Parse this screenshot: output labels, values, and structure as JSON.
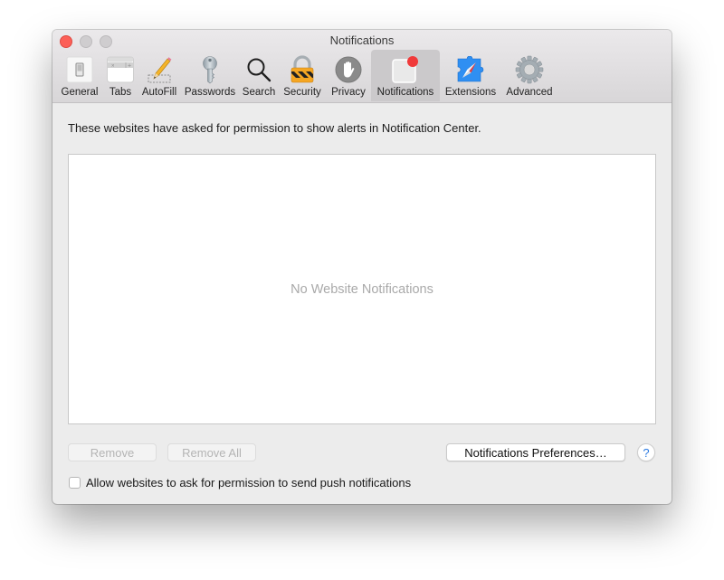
{
  "window": {
    "title": "Notifications",
    "controls": [
      "close",
      "minimize",
      "zoom"
    ]
  },
  "toolbar": {
    "selected": "Notifications",
    "items": [
      {
        "label": "General",
        "icon": "general-switch-icon"
      },
      {
        "label": "Tabs",
        "icon": "tabs-icon"
      },
      {
        "label": "AutoFill",
        "icon": "pencil-icon"
      },
      {
        "label": "Passwords",
        "icon": "key-icon"
      },
      {
        "label": "Search",
        "icon": "magnifier-icon"
      },
      {
        "label": "Security",
        "icon": "padlock-icon"
      },
      {
        "label": "Privacy",
        "icon": "hand-icon"
      },
      {
        "label": "Notifications",
        "icon": "notification-badge-icon"
      },
      {
        "label": "Extensions",
        "icon": "puzzle-compass-icon"
      },
      {
        "label": "Advanced",
        "icon": "gear-icon"
      }
    ]
  },
  "main": {
    "description": "These websites have asked for permission to show alerts in Notification Center.",
    "list": {
      "items": [],
      "empty_text": "No Website Notifications"
    },
    "buttons": {
      "remove": "Remove",
      "remove_all": "Remove All",
      "notifications_preferences": "Notifications Preferences…",
      "help": "?"
    },
    "checkbox": {
      "label": "Allow websites to ask for permission to send push notifications",
      "checked": false
    }
  },
  "colors": {
    "close": "#fc5f57",
    "badge": "#f03a3a",
    "help_accent": "#2a7ae2",
    "extensions_blue": "#2f8ff2"
  }
}
